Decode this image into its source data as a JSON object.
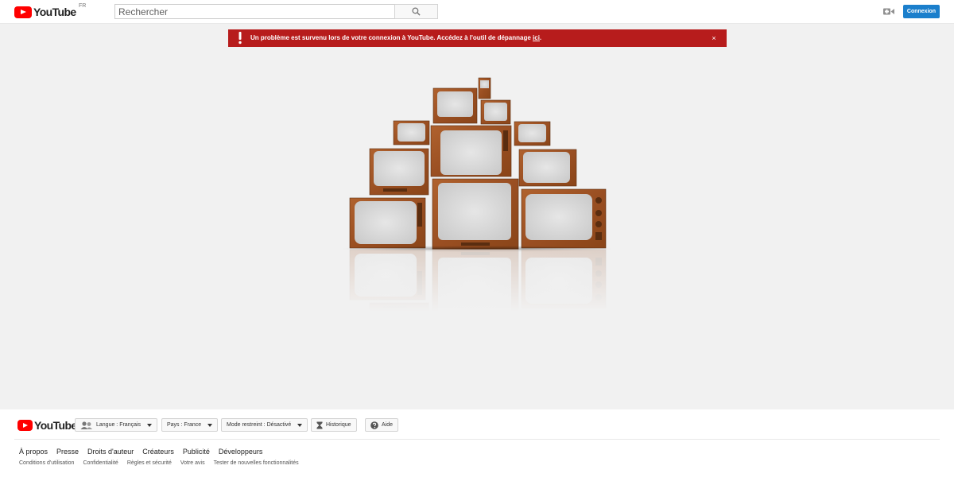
{
  "header": {
    "logo_text": "YouTube",
    "region_code": "FR",
    "search_placeholder": "Rechercher",
    "signin_label": "Connexion"
  },
  "alert": {
    "message": "Un problème est survenu lors de votre connexion à YouTube. Accédez à l'outil de dépannage ",
    "link_text": "ici",
    "trailing": ".",
    "close_glyph": "×",
    "bg_color": "#b71c1c"
  },
  "footer": {
    "logo_text": "YouTube",
    "language": "Langue : Français",
    "country": "Pays : France",
    "restricted_mode": "Mode restreint : Désactivé",
    "history": "Historique",
    "help": "Aide",
    "links_primary": [
      "À propos",
      "Presse",
      "Droits d'auteur",
      "Créateurs",
      "Publicité",
      "Développeurs"
    ],
    "links_secondary": [
      "Conditions d'utilisation",
      "Confidentialité",
      "Règles et sécurité",
      "Votre avis",
      "Tester de nouvelles fonctionnalités"
    ]
  },
  "icons": {
    "search": "search-icon",
    "upload": "video-camera-icon",
    "alert": "exclamation-icon",
    "language": "people-icon",
    "history": "hourglass-icon",
    "help": "help-icon"
  },
  "colors": {
    "brand_red": "#ff0000",
    "signin_blue": "#1b7fcc",
    "wood": "#a0522d",
    "screen": "#dcdcdc"
  }
}
